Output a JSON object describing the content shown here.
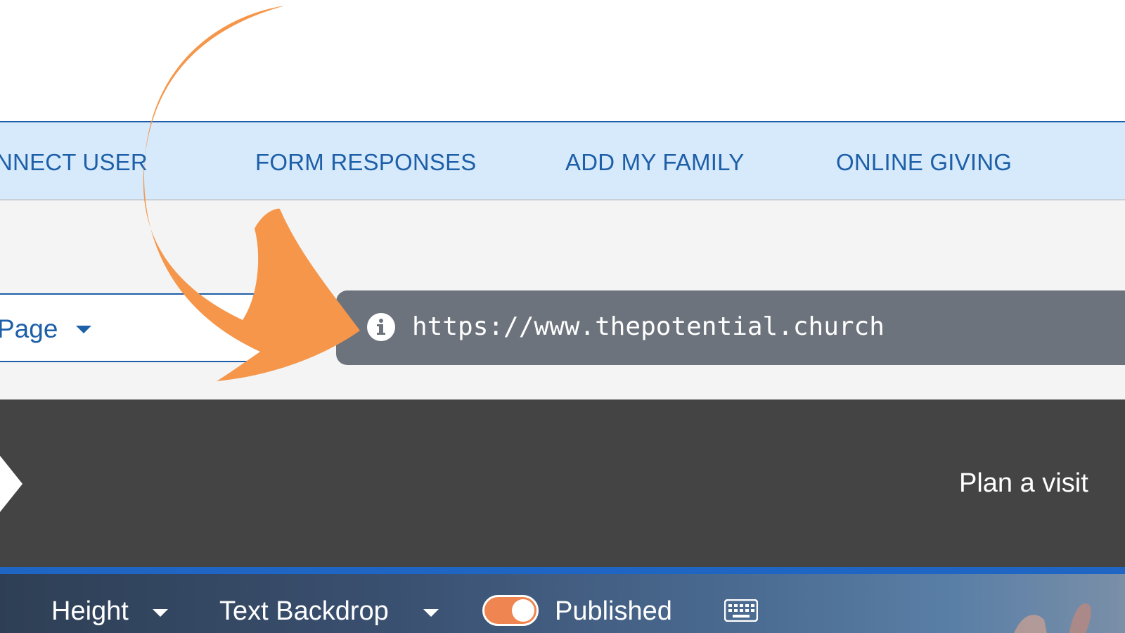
{
  "nav": {
    "items": [
      {
        "label": "NNECT USER"
      },
      {
        "label": "FORM RESPONSES"
      },
      {
        "label": "ADD MY FAMILY"
      },
      {
        "label": "ONLINE GIVING"
      }
    ]
  },
  "page_select": {
    "label": "Page"
  },
  "url_tooltip": {
    "url": "https://www.thepotential.church",
    "icon": "info-icon"
  },
  "banner": {
    "cta": "Plan a visit"
  },
  "toolbar": {
    "height_label": "Height",
    "text_backdrop_label": "Text Backdrop",
    "published_label": "Published",
    "published_on": true,
    "keyboard_icon": "keyboard-icon"
  },
  "colors": {
    "nav_bg": "#d6eafb",
    "nav_text": "#1d5fa8",
    "tooltip_bg": "#6d737c",
    "banner_bg": "#444444",
    "accent_orange": "#f5964a",
    "toggle_on": "#ef8550",
    "divider_blue": "#1f66c4"
  }
}
